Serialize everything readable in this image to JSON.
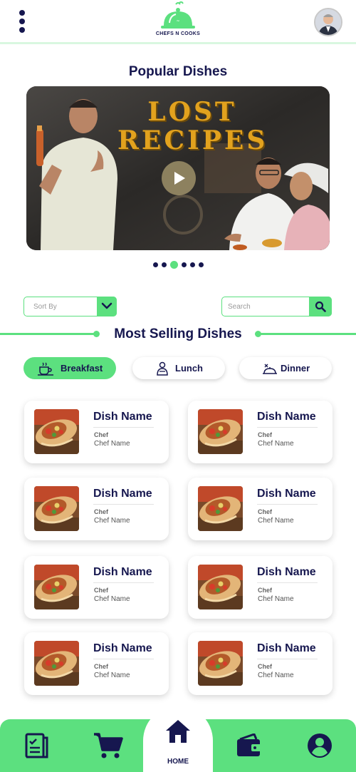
{
  "header": {
    "brand": "CHEFS N COOKS",
    "menu_icon": "kebab-menu-icon",
    "avatar_icon": "user-avatar"
  },
  "popular": {
    "title": "Popular Dishes",
    "video_title_line1": "LOST",
    "video_title_line2": "RECIPES",
    "carousel_count": 6,
    "carousel_active_index": 2
  },
  "controls": {
    "sort_label": "Sort By",
    "search_placeholder": "Search"
  },
  "most_selling": {
    "title": "Most Selling Dishes"
  },
  "tabs": [
    {
      "label": "Breakfast",
      "icon": "breakfast-icon",
      "active": true
    },
    {
      "label": "Lunch",
      "icon": "lunch-icon",
      "active": false
    },
    {
      "label": "Dinner",
      "icon": "dinner-icon",
      "active": false
    }
  ],
  "dishes": [
    {
      "name": "Dish Name",
      "chef_label": "Chef",
      "chef_name": "Chef Name"
    },
    {
      "name": "Dish Name",
      "chef_label": "Chef",
      "chef_name": "Chef Name"
    },
    {
      "name": "Dish Name",
      "chef_label": "Chef",
      "chef_name": "Chef Name"
    },
    {
      "name": "Dish Name",
      "chef_label": "Chef",
      "chef_name": "Chef Name"
    },
    {
      "name": "Dish Name",
      "chef_label": "Chef",
      "chef_name": "Chef Name"
    },
    {
      "name": "Dish Name",
      "chef_label": "Chef",
      "chef_name": "Chef Name"
    },
    {
      "name": "Dish Name",
      "chef_label": "Chef",
      "chef_name": "Chef Name"
    },
    {
      "name": "Dish Name",
      "chef_label": "Chef",
      "chef_name": "Chef Name"
    }
  ],
  "bottom_nav": {
    "home_label": "HOME",
    "items": [
      "orders-icon",
      "cart-icon",
      "home-icon",
      "wallet-icon",
      "profile-icon"
    ]
  },
  "colors": {
    "accent": "#5ce07f",
    "navy": "#16174f"
  }
}
